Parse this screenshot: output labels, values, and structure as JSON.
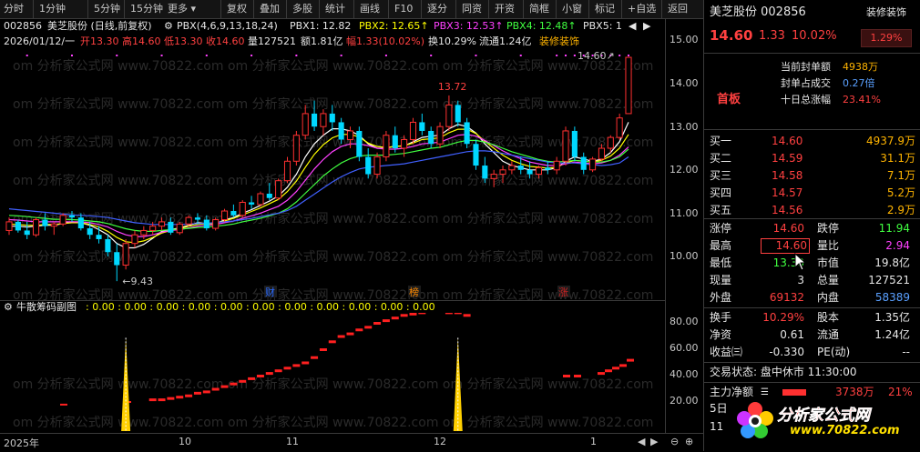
{
  "toolbar": {
    "items": [
      "分时",
      "1分钟",
      "5分钟",
      "15分钟",
      "更多",
      "复权",
      "叠加",
      "多股",
      "统计",
      "画线",
      "F10",
      "逐分",
      "同资",
      "开资",
      "简框",
      "小窗",
      "标记",
      "+自选",
      "返回"
    ]
  },
  "info": {
    "code": "002856",
    "name_period": "美芝股份 (日线,前复权)",
    "pbx_params": "PBX(4,6,9,13,18,24)",
    "pbx1": "PBX1: 12.82",
    "pbx2": "PBX2: 12.65↑",
    "pbx3": "PBX3: 12.53↑",
    "pbx4": "PBX4: 12.48↑",
    "pbx5": "PBX5: 1"
  },
  "ohlc": {
    "date": "2026/01/12/一",
    "open": "开13.30",
    "high": "高14.60",
    "low": "低13.30",
    "close": "收14.60",
    "volume": "量127521",
    "amount": "额1.81亿",
    "change": "幅1.33(10.02%)",
    "turnover": "换10.29%",
    "float": "流通1.24亿",
    "industry": "装修装饰"
  },
  "chart_data": {
    "type": "candlestick",
    "y_ticks": [
      "15.00",
      "14.00",
      "13.00",
      "12.00",
      "11.00",
      "10.00"
    ],
    "ylim": [
      9.2,
      15.2
    ],
    "annotations": {
      "high_label": "13.72",
      "low_label": "9.43",
      "last_label": "14.60"
    },
    "markers": [
      "财",
      "榜",
      "涨"
    ],
    "x_labels": [
      "2025年",
      "10",
      "11",
      "12",
      "1"
    ],
    "candles": [
      [
        10.6,
        10.9,
        10.5,
        10.8
      ],
      [
        10.8,
        10.85,
        10.55,
        10.6
      ],
      [
        10.6,
        10.8,
        10.4,
        10.5
      ],
      [
        10.5,
        10.9,
        10.45,
        10.85
      ],
      [
        10.85,
        11.0,
        10.6,
        10.7
      ],
      [
        10.7,
        10.8,
        10.5,
        10.75
      ],
      [
        10.75,
        11.0,
        10.7,
        10.95
      ],
      [
        10.95,
        11.05,
        10.8,
        10.9
      ],
      [
        10.9,
        11.0,
        10.6,
        10.65
      ],
      [
        10.65,
        10.8,
        10.4,
        10.5
      ],
      [
        10.5,
        10.7,
        10.3,
        10.4
      ],
      [
        10.4,
        10.5,
        10.0,
        10.1
      ],
      [
        10.1,
        10.3,
        9.43,
        9.8
      ],
      [
        9.8,
        10.4,
        9.7,
        10.3
      ],
      [
        10.3,
        10.6,
        10.2,
        10.5
      ],
      [
        10.5,
        10.7,
        10.4,
        10.6
      ],
      [
        10.6,
        10.8,
        10.5,
        10.7
      ],
      [
        10.7,
        10.9,
        10.6,
        10.8
      ],
      [
        10.8,
        10.9,
        10.5,
        10.55
      ],
      [
        10.55,
        10.8,
        10.5,
        10.75
      ],
      [
        10.75,
        10.95,
        10.7,
        10.9
      ],
      [
        10.9,
        11.0,
        10.75,
        10.85
      ],
      [
        10.85,
        10.95,
        10.6,
        10.65
      ],
      [
        10.65,
        10.9,
        10.6,
        10.85
      ],
      [
        10.85,
        11.1,
        10.8,
        11.05
      ],
      [
        11.05,
        11.2,
        10.9,
        10.95
      ],
      [
        10.95,
        11.3,
        10.9,
        11.25
      ],
      [
        11.25,
        11.4,
        11.1,
        11.2
      ],
      [
        11.2,
        11.5,
        11.15,
        11.45
      ],
      [
        11.45,
        11.7,
        11.3,
        11.35
      ],
      [
        11.35,
        11.8,
        11.3,
        11.75
      ],
      [
        11.75,
        12.3,
        11.7,
        12.2
      ],
      [
        12.2,
        12.9,
        12.1,
        12.8
      ],
      [
        12.8,
        13.5,
        12.7,
        13.3
      ],
      [
        13.3,
        13.6,
        12.9,
        13.0
      ],
      [
        13.0,
        13.4,
        12.8,
        13.3
      ],
      [
        13.3,
        13.5,
        12.9,
        13.1
      ],
      [
        13.1,
        13.2,
        12.6,
        12.7
      ],
      [
        12.7,
        13.0,
        12.5,
        12.9
      ],
      [
        12.9,
        13.0,
        12.2,
        12.3
      ],
      [
        12.3,
        12.5,
        11.8,
        11.9
      ],
      [
        11.9,
        12.4,
        11.8,
        12.3
      ],
      [
        12.3,
        12.9,
        12.2,
        12.8
      ],
      [
        12.8,
        13.0,
        12.4,
        12.5
      ],
      [
        12.5,
        12.8,
        12.3,
        12.7
      ],
      [
        12.7,
        13.2,
        12.6,
        13.1
      ],
      [
        13.1,
        13.3,
        12.8,
        12.9
      ],
      [
        12.9,
        13.0,
        12.5,
        12.6
      ],
      [
        12.6,
        13.1,
        12.5,
        13.0
      ],
      [
        13.0,
        13.72,
        12.9,
        13.5
      ],
      [
        13.5,
        13.6,
        13.0,
        13.1
      ],
      [
        13.1,
        13.2,
        12.5,
        12.6
      ],
      [
        12.6,
        12.7,
        12.0,
        12.1
      ],
      [
        12.1,
        12.3,
        11.7,
        11.8
      ],
      [
        11.8,
        12.0,
        11.6,
        11.9
      ],
      [
        11.9,
        12.1,
        11.7,
        12.0
      ],
      [
        12.0,
        12.2,
        11.9,
        12.1
      ],
      [
        12.1,
        12.3,
        11.9,
        12.0
      ],
      [
        12.0,
        12.2,
        11.8,
        11.9
      ],
      [
        11.9,
        12.1,
        11.8,
        12.05
      ],
      [
        12.05,
        12.2,
        11.9,
        12.0
      ],
      [
        12.0,
        12.3,
        11.9,
        12.2
      ],
      [
        12.2,
        13.0,
        12.1,
        12.9
      ],
      [
        12.9,
        13.0,
        12.2,
        12.3
      ],
      [
        12.3,
        12.4,
        11.9,
        12.0
      ],
      [
        12.0,
        12.3,
        11.95,
        12.25
      ],
      [
        12.25,
        12.6,
        12.2,
        12.5
      ],
      [
        12.5,
        12.8,
        12.4,
        12.75
      ],
      [
        12.75,
        13.3,
        12.7,
        13.2
      ],
      [
        13.3,
        14.6,
        13.3,
        14.6
      ]
    ],
    "ma_series": [
      {
        "color": "#ffffff",
        "values": [
          10.7,
          10.7,
          10.68,
          10.7,
          10.72,
          10.72,
          10.76,
          10.8,
          10.78,
          10.72,
          10.62,
          10.5,
          10.3,
          10.2,
          10.2,
          10.28,
          10.42,
          10.58,
          10.62,
          10.66,
          10.72,
          10.78,
          10.76,
          10.76,
          10.84,
          10.9,
          11.0,
          11.08,
          11.18,
          11.28,
          11.4,
          11.6,
          11.9,
          12.3,
          12.6,
          12.8,
          12.95,
          12.95,
          12.9,
          12.8,
          12.6,
          12.5,
          12.5,
          12.55,
          12.55,
          12.65,
          12.75,
          12.78,
          12.8,
          12.95,
          13.05,
          13.0,
          12.85,
          12.6,
          12.4,
          12.2,
          12.1,
          12.05,
          12.0,
          12.0,
          12.0,
          12.05,
          12.2,
          12.3,
          12.25,
          12.2,
          12.25,
          12.4,
          12.65,
          13.1
        ]
      },
      {
        "color": "#ffff00",
        "values": [
          10.75,
          10.74,
          10.72,
          10.72,
          10.74,
          10.74,
          10.76,
          10.78,
          10.78,
          10.74,
          10.68,
          10.58,
          10.44,
          10.34,
          10.32,
          10.36,
          10.44,
          10.54,
          10.6,
          10.64,
          10.7,
          10.74,
          10.76,
          10.76,
          10.82,
          10.88,
          10.96,
          11.04,
          11.12,
          11.22,
          11.32,
          11.5,
          11.74,
          12.06,
          12.36,
          12.58,
          12.74,
          12.82,
          12.82,
          12.76,
          12.62,
          12.54,
          12.52,
          12.54,
          12.56,
          12.62,
          12.7,
          12.72,
          12.74,
          12.86,
          12.94,
          12.94,
          12.84,
          12.66,
          12.5,
          12.34,
          12.22,
          12.14,
          12.08,
          12.06,
          12.04,
          12.06,
          12.16,
          12.22,
          12.2,
          12.18,
          12.22,
          12.32,
          12.5,
          12.82
        ]
      },
      {
        "color": "#ff40ff",
        "values": [
          10.85,
          10.84,
          10.82,
          10.8,
          10.8,
          10.8,
          10.8,
          10.8,
          10.8,
          10.78,
          10.74,
          10.68,
          10.58,
          10.5,
          10.46,
          10.46,
          10.5,
          10.56,
          10.6,
          10.62,
          10.66,
          10.7,
          10.72,
          10.74,
          10.78,
          10.82,
          10.88,
          10.94,
          11.0,
          11.08,
          11.16,
          11.3,
          11.5,
          11.76,
          12.02,
          12.24,
          12.42,
          12.54,
          12.6,
          12.6,
          12.56,
          12.5,
          12.48,
          12.48,
          12.5,
          12.54,
          12.6,
          12.62,
          12.64,
          12.72,
          12.8,
          12.82,
          12.78,
          12.68,
          12.56,
          12.44,
          12.34,
          12.26,
          12.18,
          12.14,
          12.1,
          12.1,
          12.14,
          12.18,
          12.16,
          12.14,
          12.16,
          12.22,
          12.34,
          12.53
        ]
      },
      {
        "color": "#40ff40",
        "values": [
          10.95,
          10.94,
          10.92,
          10.9,
          10.88,
          10.86,
          10.86,
          10.85,
          10.84,
          10.82,
          10.8,
          10.76,
          10.7,
          10.64,
          10.6,
          10.58,
          10.58,
          10.6,
          10.62,
          10.63,
          10.65,
          10.67,
          10.68,
          10.7,
          10.72,
          10.75,
          10.8,
          10.84,
          10.88,
          10.94,
          11.0,
          11.1,
          11.26,
          11.46,
          11.66,
          11.86,
          12.02,
          12.16,
          12.26,
          12.32,
          12.34,
          12.34,
          12.34,
          12.36,
          12.38,
          12.42,
          12.46,
          12.5,
          12.52,
          12.58,
          12.64,
          12.68,
          12.68,
          12.64,
          12.58,
          12.5,
          12.42,
          12.36,
          12.3,
          12.24,
          12.2,
          12.18,
          12.2,
          12.22,
          12.2,
          12.18,
          12.18,
          12.22,
          12.3,
          12.48
        ]
      },
      {
        "color": "#4060ff",
        "values": [
          11.1,
          11.08,
          11.06,
          11.04,
          11.02,
          11.0,
          10.98,
          10.96,
          10.95,
          10.94,
          10.92,
          10.9,
          10.86,
          10.82,
          10.78,
          10.76,
          10.74,
          10.74,
          10.74,
          10.74,
          10.75,
          10.76,
          10.77,
          10.78,
          10.8,
          10.82,
          10.85,
          10.88,
          10.92,
          10.96,
          11.0,
          11.06,
          11.16,
          11.3,
          11.44,
          11.58,
          11.72,
          11.84,
          11.94,
          12.02,
          12.06,
          12.08,
          12.1,
          12.12,
          12.14,
          12.18,
          12.22,
          12.26,
          12.3,
          12.34,
          12.38,
          12.42,
          12.44,
          12.44,
          12.42,
          12.38,
          12.34,
          12.3,
          12.26,
          12.22,
          12.18,
          12.16,
          12.16,
          12.16,
          12.14,
          12.12,
          12.1,
          12.12,
          12.16,
          12.3
        ]
      }
    ],
    "sub": {
      "title": "牛散筹码副图",
      "values_label": ": 0.00 : 0.00 : 0.00 : 0.00 : 0.00 : 0.00 : 0.00 : 0.00 : 0.00 : 0.00 : 0.00",
      "y_ticks": [
        "80.00",
        "60.00",
        "40.00",
        "20.00"
      ],
      "ylim": [
        0,
        90
      ],
      "bars": [
        0,
        0,
        0,
        0,
        0,
        0,
        0,
        0,
        0,
        0,
        0,
        0,
        0,
        0,
        0,
        0,
        22,
        22,
        23,
        24,
        25,
        27,
        28,
        30,
        32,
        34,
        36,
        38,
        40,
        42,
        44,
        46,
        48,
        50,
        54,
        60,
        66,
        70,
        72,
        75,
        77,
        80,
        82,
        84,
        86,
        87,
        88,
        89,
        89,
        88,
        88,
        86,
        0,
        0,
        0,
        0,
        0,
        0,
        0,
        0,
        0,
        0,
        0,
        0,
        0,
        0,
        0,
        0,
        0,
        0
      ],
      "spikes_at": [
        13,
        50
      ]
    }
  },
  "side": {
    "header": {
      "name_code": "美芝股份 002856",
      "sector_btn": "装修装饰"
    },
    "price": {
      "last": "14.60",
      "change": "1.33",
      "pct": "10.02%",
      "sector_pct": "1.29%"
    },
    "seal": [
      {
        "label": "当前封单额",
        "value": "4938万"
      },
      {
        "label": "封单占成交",
        "value": "0.27倍"
      },
      {
        "label": "十日总涨幅",
        "value": "23.41%"
      }
    ],
    "badge": "首板",
    "bids": [
      {
        "label": "买一",
        "price": "14.60",
        "vol": "4937.9万"
      },
      {
        "label": "买二",
        "price": "14.59",
        "vol": "31.1万"
      },
      {
        "label": "买三",
        "price": "14.58",
        "vol": "7.1万"
      },
      {
        "label": "买四",
        "price": "14.57",
        "vol": "5.2万"
      },
      {
        "label": "买五",
        "price": "14.56",
        "vol": "2.9万"
      }
    ],
    "stats": [
      {
        "l1": "涨停",
        "v1": "14.60",
        "l2": "跌停",
        "v2": "11.94"
      },
      {
        "l1": "最高",
        "v1": "14.60",
        "l2": "量比",
        "v2": "2.94"
      },
      {
        "l1": "最低",
        "v1": "13.30",
        "l2": "市值",
        "v2": "19.8亿"
      },
      {
        "l1": "现量",
        "v1": "3",
        "l2": "总量",
        "v2": "127521"
      },
      {
        "l1": "外盘",
        "v1": "69132",
        "l2": "内盘",
        "v2": "58389"
      }
    ],
    "stats2": [
      {
        "l1": "换手",
        "v1": "10.29%",
        "l2": "股本",
        "v2": "1.35亿"
      },
      {
        "l1": "净资",
        "v1": "0.61",
        "l2": "流通",
        "v2": "1.24亿"
      },
      {
        "l1": "收益㈢",
        "v1": "-0.330",
        "l2": "PE(动)",
        "v2": "--"
      }
    ],
    "trade_status": "交易状态: 盘中休市 11:30:00",
    "main_flow": {
      "label": "主力净额",
      "value": "3738万",
      "pct": "21%"
    },
    "day5": "5日",
    "day11": "11",
    "logo_text": "分析家公式网",
    "logo_url": "www.70822.com"
  },
  "watermark": "om 分析家公式网 www.70822.com"
}
